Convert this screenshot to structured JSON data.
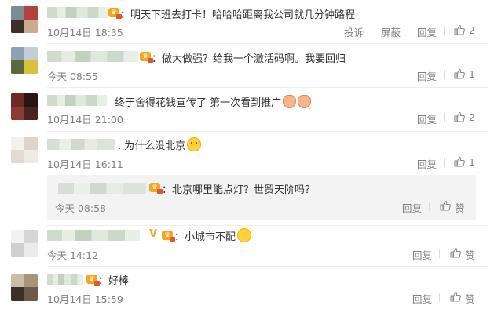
{
  "actions": {
    "report": "投诉",
    "block": "屏蔽",
    "reply": "回复",
    "like": "赞"
  },
  "comments": [
    {
      "text": "：明天下班去打卡！哈哈哈距离我公司就几分钟路程",
      "time": "10月14日 18:35",
      "likes": "2"
    },
    {
      "text": "：做大做强？给我一个激活码啊。我要回归",
      "time": "今天 08:55",
      "likes": "1"
    },
    {
      "text": "终于舍得花钱宣传了  第一次看到推广",
      "time": "10月14日 21:00",
      "likes": "2"
    },
    {
      "text": ". 为什么没北京",
      "time": "10月14日 16:11",
      "likes": "1"
    },
    {
      "text": "：北京哪里能点灯？世贸天阶吗？",
      "time": "今天 08:58",
      "likes": "赞"
    },
    {
      "text": "：小城市不配",
      "time": "今天 14:12",
      "likes": "赞"
    },
    {
      "text": "：好棒",
      "time": "10月14日 15:59",
      "likes": "赞"
    }
  ],
  "icons": {
    "like": "thumbs-up-icon",
    "vip": "membership-badge-icon",
    "verified": "verified-v-icon"
  },
  "colors": {
    "text": "#333333",
    "meta": "#808080",
    "badge": "#f5a623",
    "reply_bg": "#f3f3f3"
  }
}
